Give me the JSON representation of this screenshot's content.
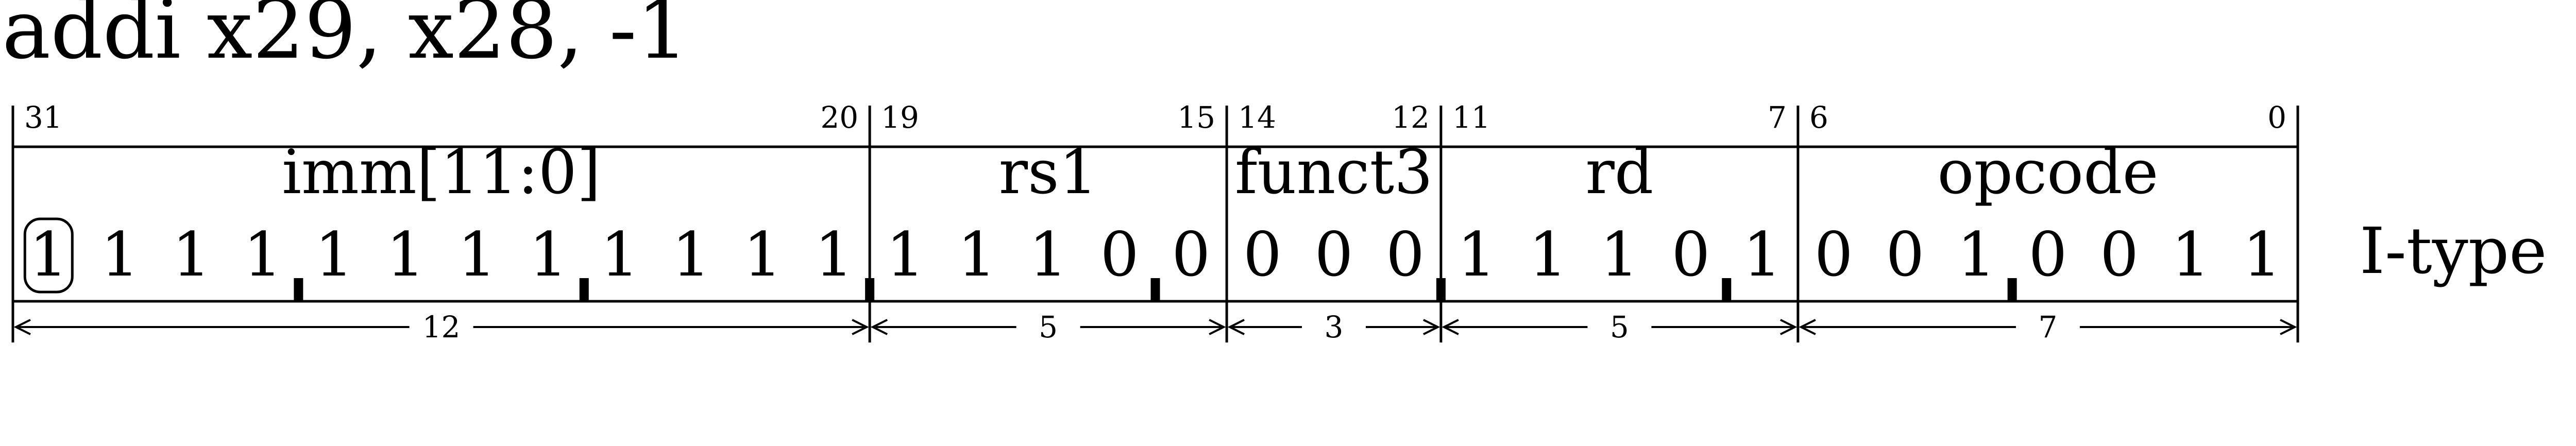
{
  "instruction": "addi x29, x28, -1",
  "format_label": "I-type",
  "fields": [
    {
      "name": "imm[11:0]",
      "hi_bit": "31",
      "lo_bit": "20",
      "width": "12",
      "bits": [
        "1",
        "1",
        "1",
        "1",
        "1",
        "1",
        "1",
        "1",
        "1",
        "1",
        "1",
        "1"
      ]
    },
    {
      "name": "rs1",
      "hi_bit": "19",
      "lo_bit": "15",
      "width": "5",
      "bits": [
        "1",
        "1",
        "1",
        "0",
        "0"
      ]
    },
    {
      "name": "funct3",
      "hi_bit": "14",
      "lo_bit": "12",
      "width": "3",
      "bits": [
        "0",
        "0",
        "0"
      ]
    },
    {
      "name": "rd",
      "hi_bit": "11",
      "lo_bit": "7",
      "width": "5",
      "bits": [
        "1",
        "1",
        "1",
        "0",
        "1"
      ]
    },
    {
      "name": "opcode",
      "hi_bit": "6",
      "lo_bit": "0",
      "width": "7",
      "bits": [
        "0",
        "0",
        "1",
        "0",
        "0",
        "1",
        "1"
      ]
    }
  ],
  "circled_bit_index": 0,
  "nibble_separators_after_bit": [
    3,
    7,
    11,
    15,
    19,
    23,
    27
  ]
}
